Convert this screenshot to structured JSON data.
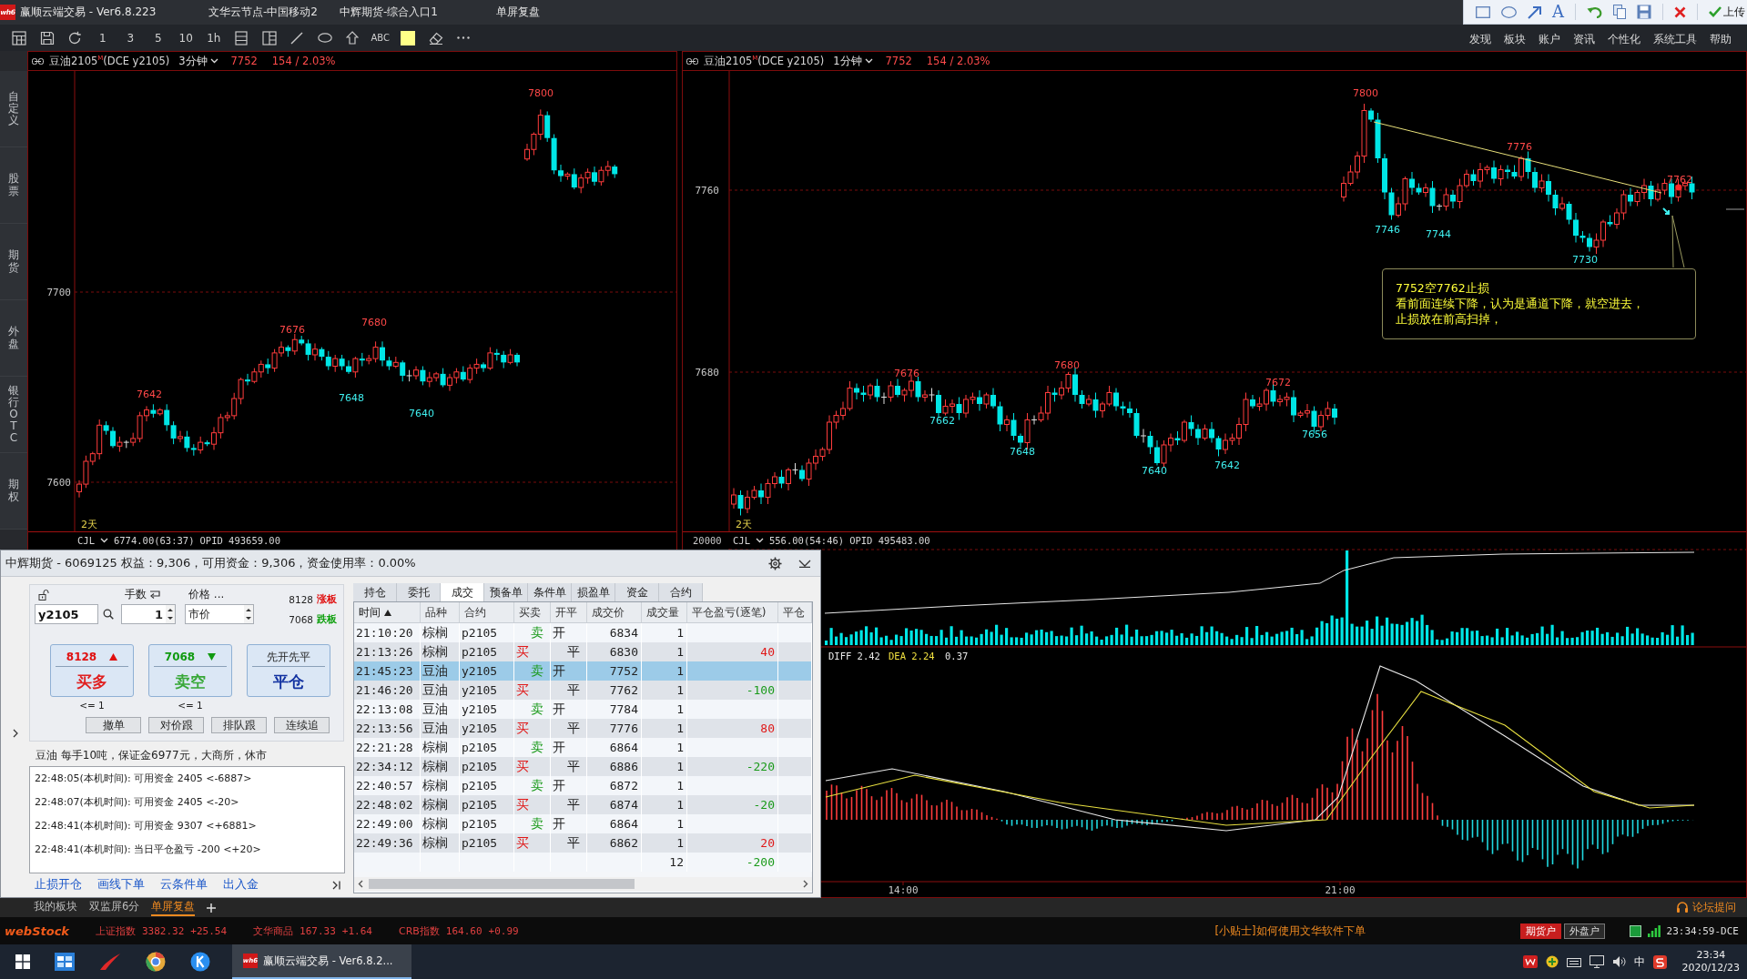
{
  "title_bar": {
    "logo": "wh6",
    "title": "赢顺云端交易 - Ver6.8.223",
    "items": [
      "文华云节点-中国移动2",
      "中辉期货-综合入口1",
      "单屏复盘"
    ]
  },
  "drawing_toolbar": {
    "text_tool": "A",
    "upload": "上传"
  },
  "toolbar": {
    "periods": [
      "1",
      "3",
      "5",
      "10",
      "1h"
    ],
    "text_tool": "ABC"
  },
  "menu": [
    "发现",
    "板块",
    "账户",
    "资讯",
    "个性化",
    "系统工具",
    "帮助"
  ],
  "sidebar": {
    "tabs": [
      "自定义",
      "股票",
      "期货",
      "外盘",
      "银行OTC",
      "期权"
    ]
  },
  "charts": [
    {
      "symbol": "豆油2105$^{M}$(DCE y2105)",
      "period": "3分钟",
      "price": "7752",
      "change": "154 / 2.03%",
      "price_axis": [
        "7700",
        "7600"
      ],
      "price_labels": [
        {
          "text": "7800",
          "kind": "high"
        },
        {
          "text": "7680",
          "kind": "high"
        },
        {
          "text": "7676",
          "kind": "high"
        },
        {
          "text": "7642",
          "kind": "high"
        },
        {
          "text": "7648",
          "kind": "low"
        },
        {
          "text": "7640",
          "kind": "low"
        }
      ],
      "range": "2天",
      "indicator": {
        "name": "CJL",
        "reading": "6774.00(63:37)",
        "opid": "OPID 493659.00"
      }
    },
    {
      "symbol": "豆油2105$^{M}$(DCE y2105)",
      "period": "1分钟",
      "price": "7752",
      "change": "154 / 2.03%",
      "price_axis": [
        "7760",
        "7680"
      ],
      "price_labels": [
        {
          "text": "7800",
          "kind": "high"
        },
        {
          "text": "7776",
          "kind": "high"
        },
        {
          "text": "7762",
          "kind": "high"
        },
        {
          "text": "7746",
          "kind": "low"
        },
        {
          "text": "7744",
          "kind": "low"
        },
        {
          "text": "7730",
          "kind": "low"
        },
        {
          "text": "7680",
          "kind": "high"
        },
        {
          "text": "7676",
          "kind": "high"
        },
        {
          "text": "7672",
          "kind": "high"
        },
        {
          "text": "7656",
          "kind": "low"
        },
        {
          "text": "7662",
          "kind": "low"
        },
        {
          "text": "7642",
          "kind": "low"
        },
        {
          "text": "7648",
          "kind": "low"
        },
        {
          "text": "7640",
          "kind": "low"
        }
      ],
      "note": [
        "7752空7762止损",
        "看前面连续下降，认为是通道下降，就空进去，",
        "止损放在前高扫掉，"
      ],
      "range": "2天",
      "volume_axis": "20000",
      "indicator": {
        "name": "CJL",
        "reading": "556.00(54:46)",
        "opid": "OPID 495483.00"
      },
      "macd": {
        "diff": "DIFF 2.42",
        "dea": "DEA 2.24",
        "value": "0.37"
      },
      "time_axis": [
        "14:00",
        "21:00"
      ]
    }
  ],
  "trade_panel": {
    "header": "中辉期货 - 6069125 权益：9,306，可用资金：9,306，资金使用率：0.00%",
    "order_form": {
      "contract": "y2105",
      "lots_label": "手数",
      "lots": "1",
      "price_label": "价格 ...",
      "price_type": "市价",
      "limit_up": {
        "price": "8128",
        "label": "涨板"
      },
      "limit_down": {
        "price": "7068",
        "label": "跌板"
      },
      "buttons": [
        {
          "kind": "buy",
          "price": "8128",
          "label": "买多",
          "limit": "<= 1"
        },
        {
          "kind": "sell",
          "price": "7068",
          "label": "卖空",
          "limit": "<= 1"
        },
        {
          "kind": "close",
          "caption": "先开先平",
          "label": "平仓"
        }
      ],
      "actions": [
        "撤单",
        "对价跟",
        "排队跟",
        "连续追"
      ]
    },
    "contract_info": "豆油 每手10吨，保证金6977元，大商所，休市",
    "log": [
      "22:48:05(本机时间): 可用资金 2405 <-6887>",
      "22:48:07(本机时间): 可用资金 2405 <-20>",
      "22:48:41(本机时间): 可用资金 9307 <+6881>",
      "22:48:41(本机时间): 当日平仓盈亏 -200 <+20>"
    ],
    "links": [
      "止损开仓",
      "画线下单",
      "云条件单",
      "出入金"
    ],
    "tabs": [
      {
        "label": "持仓",
        "selected": false
      },
      {
        "label": "委托",
        "selected": false
      },
      {
        "label": "成交",
        "selected": true
      },
      {
        "label": "预备单",
        "selected": false
      },
      {
        "label": "条件单",
        "selected": false
      },
      {
        "label": "损盈单",
        "selected": false
      },
      {
        "label": "资金",
        "selected": false
      },
      {
        "label": "合约",
        "selected": false
      }
    ],
    "table": {
      "columns": [
        {
          "label": "时间",
          "sorted": true
        },
        {
          "label": "品种",
          "sorted": false
        },
        {
          "label": "合约",
          "sorted": false
        },
        {
          "label": "买卖",
          "sorted": false
        },
        {
          "label": "开平",
          "sorted": false
        },
        {
          "label": "成交价",
          "sorted": false
        },
        {
          "label": "成交量",
          "sorted": false
        },
        {
          "label": "平仓盈亏(逐笔)",
          "sorted": false
        },
        {
          "label": "平仓",
          "sorted": false
        }
      ],
      "rows": [
        {
          "kind": "sell",
          "time": "21:10:20",
          "product": "棕榈",
          "contract": "p2105",
          "side": "卖",
          "action": "开",
          "price": "6834",
          "volume": "1",
          "selected": false
        },
        {
          "kind": "buy",
          "time": "21:13:26",
          "product": "棕榈",
          "contract": "p2105",
          "side": "买",
          "action": "平",
          "price": "6830",
          "volume": "1",
          "pnl": {
            "value": "40",
            "kind": "gain"
          },
          "selected": false
        },
        {
          "kind": "sell",
          "time": "21:45:23",
          "product": "豆油",
          "contract": "y2105",
          "side": "卖",
          "action": "开",
          "price": "7752",
          "volume": "1",
          "selected": true
        },
        {
          "kind": "buy",
          "time": "21:46:20",
          "product": "豆油",
          "contract": "y2105",
          "side": "买",
          "action": "平",
          "price": "7762",
          "volume": "1",
          "pnl": {
            "value": "-100",
            "kind": "loss"
          },
          "selected": false
        },
        {
          "kind": "sell",
          "time": "22:13:08",
          "product": "豆油",
          "contract": "y2105",
          "side": "卖",
          "action": "开",
          "price": "7784",
          "volume": "1",
          "selected": false
        },
        {
          "kind": "buy",
          "time": "22:13:56",
          "product": "豆油",
          "contract": "y2105",
          "side": "买",
          "action": "平",
          "price": "7776",
          "volume": "1",
          "pnl": {
            "value": "80",
            "kind": "gain"
          },
          "selected": false
        },
        {
          "kind": "sell",
          "time": "22:21:28",
          "product": "棕榈",
          "contract": "p2105",
          "side": "卖",
          "action": "开",
          "price": "6864",
          "volume": "1",
          "selected": false
        },
        {
          "kind": "buy",
          "time": "22:34:12",
          "product": "棕榈",
          "contract": "p2105",
          "side": "买",
          "action": "平",
          "price": "6886",
          "volume": "1",
          "pnl": {
            "value": "-220",
            "kind": "loss"
          },
          "selected": false
        },
        {
          "kind": "sell",
          "time": "22:40:57",
          "product": "棕榈",
          "contract": "p2105",
          "side": "卖",
          "action": "开",
          "price": "6872",
          "volume": "1",
          "selected": false
        },
        {
          "kind": "buy",
          "time": "22:48:02",
          "product": "棕榈",
          "contract": "p2105",
          "side": "买",
          "action": "平",
          "price": "6874",
          "volume": "1",
          "pnl": {
            "value": "-20",
            "kind": "loss"
          },
          "selected": false
        },
        {
          "kind": "sell",
          "time": "22:49:00",
          "product": "棕榈",
          "contract": "p2105",
          "side": "卖",
          "action": "开",
          "price": "6864",
          "volume": "1",
          "selected": false
        },
        {
          "kind": "buy",
          "time": "22:49:36",
          "product": "棕榈",
          "contract": "p2105",
          "side": "买",
          "action": "平",
          "price": "6862",
          "volume": "1",
          "pnl": {
            "value": "20",
            "kind": "gain"
          },
          "selected": false
        }
      ],
      "totals": {
        "volume": "12",
        "pnl": {
          "value": "-200",
          "kind": "loss"
        }
      }
    }
  },
  "bottom_tabs": {
    "tabs": [
      {
        "label": "我的板块",
        "selected": false
      },
      {
        "label": "双监屏6分",
        "selected": false
      },
      {
        "label": "单屏复盘",
        "selected": true
      }
    ],
    "forum": "论坛提问"
  },
  "status_bar": {
    "logo": "webStock",
    "indices": [
      {
        "name": "上证指数",
        "value": "3382.32",
        "change": "+25.54"
      },
      {
        "name": "文华商品",
        "value": "167.33",
        "change": "+1.64"
      },
      {
        "name": "CRB指数",
        "value": "164.60",
        "change": "+0.99"
      }
    ],
    "tip": "[小贴士]如何使用文华软件下单",
    "accounts": [
      {
        "label": "期货户",
        "selected": true
      },
      {
        "label": "外盘户",
        "selected": false
      }
    ],
    "clock": "23:34:59-DCE"
  },
  "taskbar": {
    "app": {
      "logo": "wh6",
      "label": "赢顺云端交易 - Ver6.8.2..."
    },
    "ime": "中",
    "time": "23:34",
    "date": "2020/12/23"
  }
}
